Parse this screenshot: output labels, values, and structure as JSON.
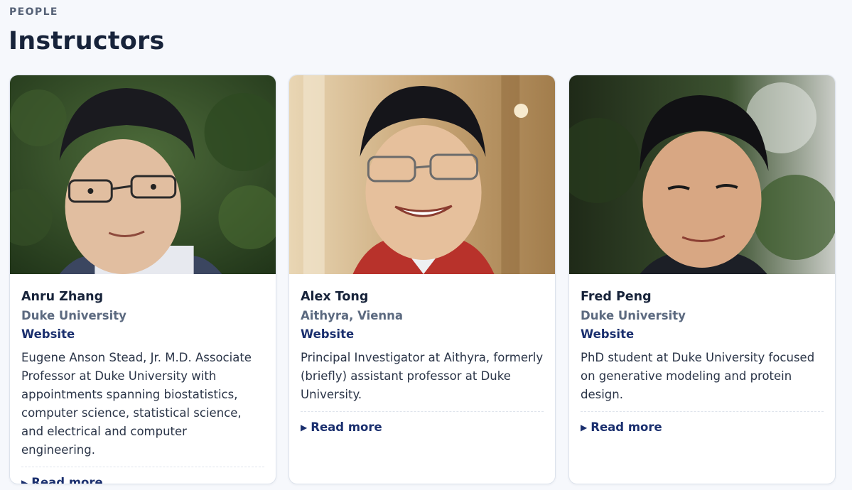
{
  "section": {
    "eyebrow": "PEOPLE",
    "title": "Instructors"
  },
  "instructors": [
    {
      "name": "Anru Zhang",
      "affiliation": "Duke University",
      "website_label": "Website",
      "bio": "Eugene Anson Stead, Jr. M.D. Associate Professor at Duke University with appointments spanning biostatistics, computer science, statistical science, and electrical and computer engineering.",
      "read_more_label": "Read more",
      "read_more_icon": "triangle-right-icon"
    },
    {
      "name": "Alex Tong",
      "affiliation": "Aithyra, Vienna",
      "website_label": "Website",
      "bio": "Principal Investigator at Aithyra, formerly (briefly) assistant professor at Duke University.",
      "read_more_label": "Read more",
      "read_more_icon": "triangle-right-icon"
    },
    {
      "name": "Fred Peng",
      "affiliation": "Duke University",
      "website_label": "Website",
      "bio": "PhD student at Duke University focused on generative modeling and protein design.",
      "read_more_label": "Read more",
      "read_more_icon": "triangle-right-icon"
    }
  ],
  "colors": {
    "accent": "#1a2f6e",
    "muted": "#5c6a80",
    "heading": "#17233a",
    "background": "#f6f8fc"
  }
}
